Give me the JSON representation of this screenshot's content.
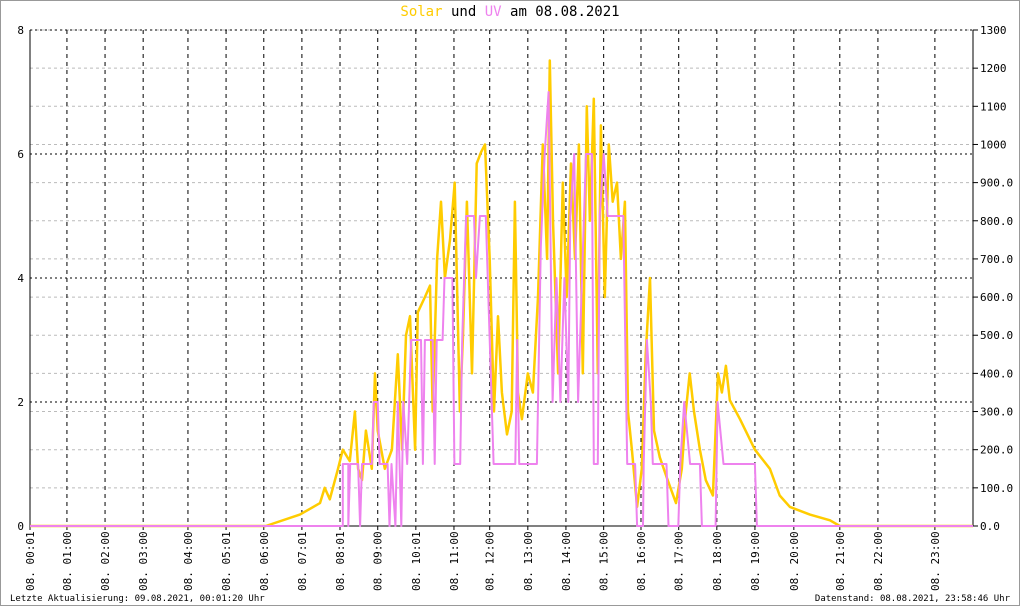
{
  "title": {
    "solar": "Solar",
    "und": "und",
    "uv": "UV",
    "rest": "am 08.08.2021"
  },
  "footer": {
    "left": "Letzte Aktualisierung: 09.08.2021, 00:01:20 Uhr",
    "right": "Datenstand: 08.08.2021, 23:58:46 Uhr"
  },
  "chart_data": {
    "type": "line",
    "title": "Solar und UV am 08.08.2021",
    "colors": {
      "solar": "#ffcc00",
      "uv": "#ee82ee",
      "grid": "#000000",
      "minor_grid": "#bbbbbb"
    },
    "xlim": [
      0,
      24
    ],
    "x_ticks": [
      {
        "x": 0,
        "label": "08. 00:01"
      },
      {
        "x": 0.94,
        "label": "08. 01:00"
      },
      {
        "x": 1.91,
        "label": "08. 02:00"
      },
      {
        "x": 2.88,
        "label": "08. 03:00"
      },
      {
        "x": 4.02,
        "label": "08. 04:00"
      },
      {
        "x": 4.99,
        "label": "08. 05:01"
      },
      {
        "x": 5.95,
        "label": "08. 06:00"
      },
      {
        "x": 6.92,
        "label": "08. 07:01"
      },
      {
        "x": 7.89,
        "label": "08. 08:01"
      },
      {
        "x": 8.85,
        "label": "08. 09:00"
      },
      {
        "x": 9.82,
        "label": "08. 10:01"
      },
      {
        "x": 10.79,
        "label": "08. 11:00"
      },
      {
        "x": 11.7,
        "label": "08. 12:00"
      },
      {
        "x": 12.67,
        "label": "08. 13:00"
      },
      {
        "x": 13.64,
        "label": "08. 14:00"
      },
      {
        "x": 14.6,
        "label": "08. 15:00"
      },
      {
        "x": 15.55,
        "label": "08. 16:00"
      },
      {
        "x": 16.51,
        "label": "08. 17:00"
      },
      {
        "x": 17.48,
        "label": "08. 18:00"
      },
      {
        "x": 18.45,
        "label": "08. 19:00"
      },
      {
        "x": 19.44,
        "label": "08. 20:00"
      },
      {
        "x": 20.61,
        "label": "08. 21:00"
      },
      {
        "x": 21.58,
        "label": "08. 22:00"
      },
      {
        "x": 23.03,
        "label": "08. 23:00"
      }
    ],
    "y_left": {
      "label": "UV",
      "ylim": [
        0,
        8
      ],
      "ticks": [
        "0",
        "2",
        "4",
        "6",
        "8"
      ]
    },
    "y_right": {
      "label": "Solar",
      "ylim": [
        0,
        1300
      ],
      "ticks": [
        "0.0",
        "100.0",
        "200.0",
        "300.0",
        "400.0",
        "500.0",
        "600.0",
        "700.0",
        "800.0",
        "900.0",
        "1000",
        "1100",
        "1200",
        "1300"
      ]
    },
    "series": [
      {
        "name": "Solar",
        "axis": "right",
        "points": [
          [
            0,
            0
          ],
          [
            6.0,
            0
          ],
          [
            6.87,
            30
          ],
          [
            7.38,
            60
          ],
          [
            7.5,
            100
          ],
          [
            7.63,
            70
          ],
          [
            7.84,
            150
          ],
          [
            7.96,
            200
          ],
          [
            8.14,
            170
          ],
          [
            8.27,
            300
          ],
          [
            8.35,
            150
          ],
          [
            8.45,
            120
          ],
          [
            8.55,
            250
          ],
          [
            8.7,
            150
          ],
          [
            8.78,
            400
          ],
          [
            8.85,
            250
          ],
          [
            9.03,
            150
          ],
          [
            9.21,
            200
          ],
          [
            9.36,
            450
          ],
          [
            9.47,
            200
          ],
          [
            9.57,
            500
          ],
          [
            9.67,
            550
          ],
          [
            9.8,
            200
          ],
          [
            9.87,
            560
          ],
          [
            10.05,
            600
          ],
          [
            10.18,
            630
          ],
          [
            10.25,
            300
          ],
          [
            10.36,
            700
          ],
          [
            10.46,
            850
          ],
          [
            10.56,
            650
          ],
          [
            10.69,
            750
          ],
          [
            10.81,
            900
          ],
          [
            10.94,
            300
          ],
          [
            11.02,
            500
          ],
          [
            11.12,
            850
          ],
          [
            11.25,
            400
          ],
          [
            11.37,
            950
          ],
          [
            11.48,
            980
          ],
          [
            11.58,
            1000
          ],
          [
            11.7,
            700
          ],
          [
            11.81,
            300
          ],
          [
            11.91,
            550
          ],
          [
            12.01,
            350
          ],
          [
            12.14,
            240
          ],
          [
            12.26,
            300
          ],
          [
            12.34,
            850
          ],
          [
            12.42,
            350
          ],
          [
            12.52,
            280
          ],
          [
            12.67,
            400
          ],
          [
            12.8,
            350
          ],
          [
            12.93,
            600
          ],
          [
            13.05,
            1000
          ],
          [
            13.16,
            700
          ],
          [
            13.23,
            1220
          ],
          [
            13.31,
            800
          ],
          [
            13.44,
            400
          ],
          [
            13.56,
            900
          ],
          [
            13.66,
            600
          ],
          [
            13.77,
            950
          ],
          [
            13.87,
            700
          ],
          [
            13.97,
            1000
          ],
          [
            14.07,
            400
          ],
          [
            14.17,
            1100
          ],
          [
            14.25,
            800
          ],
          [
            14.35,
            1120
          ],
          [
            14.45,
            400
          ],
          [
            14.53,
            1050
          ],
          [
            14.63,
            600
          ],
          [
            14.73,
            1000
          ],
          [
            14.83,
            850
          ],
          [
            14.94,
            900
          ],
          [
            15.04,
            700
          ],
          [
            15.14,
            850
          ],
          [
            15.22,
            300
          ],
          [
            15.32,
            200
          ],
          [
            15.45,
            50
          ],
          [
            15.57,
            150
          ],
          [
            15.67,
            450
          ],
          [
            15.78,
            650
          ],
          [
            15.88,
            250
          ],
          [
            16.03,
            180
          ],
          [
            16.23,
            120
          ],
          [
            16.44,
            60
          ],
          [
            16.59,
            150
          ],
          [
            16.69,
            300
          ],
          [
            16.79,
            400
          ],
          [
            16.9,
            300
          ],
          [
            17.05,
            200
          ],
          [
            17.2,
            120
          ],
          [
            17.38,
            80
          ],
          [
            17.51,
            400
          ],
          [
            17.61,
            350
          ],
          [
            17.71,
            420
          ],
          [
            17.81,
            330
          ],
          [
            18.07,
            280
          ],
          [
            18.45,
            200
          ],
          [
            18.83,
            150
          ],
          [
            19.08,
            80
          ],
          [
            19.34,
            50
          ],
          [
            19.85,
            30
          ],
          [
            20.36,
            15
          ],
          [
            20.61,
            0
          ],
          [
            24,
            0
          ]
        ]
      },
      {
        "name": "UV",
        "axis": "left",
        "points": [
          [
            0,
            0
          ],
          [
            7.96,
            0
          ],
          [
            7.96,
            1
          ],
          [
            8.1,
            1
          ],
          [
            8.1,
            0
          ],
          [
            8.15,
            1
          ],
          [
            8.35,
            1
          ],
          [
            8.4,
            0
          ],
          [
            8.45,
            1
          ],
          [
            8.7,
            1
          ],
          [
            8.75,
            2
          ],
          [
            8.85,
            2
          ],
          [
            8.9,
            1
          ],
          [
            9.1,
            1
          ],
          [
            9.15,
            0
          ],
          [
            9.2,
            1
          ],
          [
            9.3,
            0
          ],
          [
            9.36,
            2
          ],
          [
            9.45,
            0
          ],
          [
            9.5,
            2
          ],
          [
            9.6,
            1
          ],
          [
            9.7,
            3
          ],
          [
            9.95,
            3
          ],
          [
            10.0,
            1
          ],
          [
            10.05,
            3
          ],
          [
            10.25,
            3
          ],
          [
            10.3,
            1
          ],
          [
            10.35,
            3
          ],
          [
            10.5,
            3
          ],
          [
            10.55,
            4
          ],
          [
            10.75,
            4
          ],
          [
            10.8,
            1
          ],
          [
            10.95,
            1
          ],
          [
            11.0,
            3
          ],
          [
            11.1,
            5
          ],
          [
            11.3,
            5
          ],
          [
            11.35,
            4
          ],
          [
            11.45,
            5
          ],
          [
            11.6,
            5
          ],
          [
            11.7,
            3
          ],
          [
            11.8,
            1
          ],
          [
            12.35,
            1
          ],
          [
            12.4,
            3
          ],
          [
            12.45,
            1
          ],
          [
            12.9,
            1
          ],
          [
            13.0,
            4.5
          ],
          [
            13.1,
            6
          ],
          [
            13.2,
            7
          ],
          [
            13.3,
            2
          ],
          [
            13.4,
            4
          ],
          [
            13.5,
            2
          ],
          [
            13.6,
            4
          ],
          [
            13.7,
            2
          ],
          [
            13.75,
            5
          ],
          [
            13.85,
            6
          ],
          [
            13.95,
            2
          ],
          [
            14.05,
            4
          ],
          [
            14.15,
            6
          ],
          [
            14.3,
            6
          ],
          [
            14.35,
            1
          ],
          [
            14.45,
            1
          ],
          [
            14.5,
            5
          ],
          [
            14.6,
            6
          ],
          [
            14.7,
            5
          ],
          [
            15.1,
            5
          ],
          [
            15.2,
            1
          ],
          [
            15.4,
            1
          ],
          [
            15.45,
            0
          ],
          [
            15.6,
            0
          ],
          [
            15.62,
            1
          ],
          [
            15.7,
            3
          ],
          [
            15.8,
            2
          ],
          [
            15.85,
            1
          ],
          [
            16.2,
            1
          ],
          [
            16.25,
            0
          ],
          [
            16.5,
            0
          ],
          [
            16.55,
            1
          ],
          [
            16.65,
            2
          ],
          [
            16.8,
            1
          ],
          [
            17.05,
            1
          ],
          [
            17.1,
            0
          ],
          [
            17.45,
            0
          ],
          [
            17.5,
            2
          ],
          [
            17.65,
            1
          ],
          [
            18.45,
            1
          ],
          [
            18.5,
            0
          ],
          [
            24,
            0
          ]
        ]
      }
    ]
  }
}
